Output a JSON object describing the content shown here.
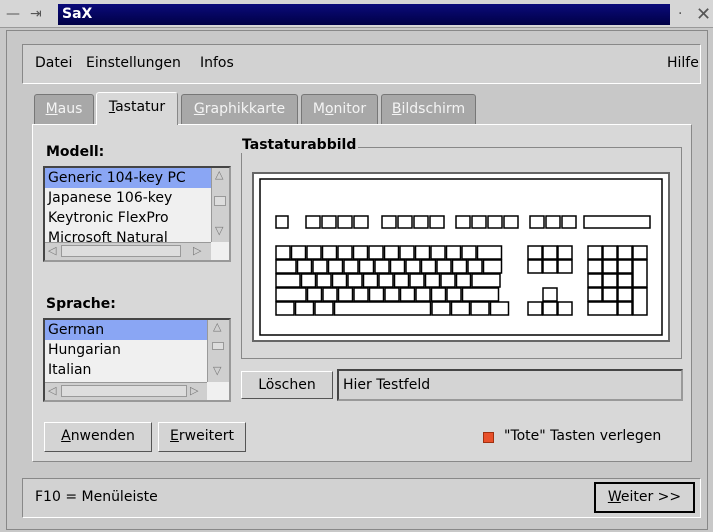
{
  "window": {
    "title": "SaX"
  },
  "menu": {
    "items": [
      "Datei",
      "Einstellungen",
      "Infos"
    ],
    "help": "Hilfe"
  },
  "tabs": [
    {
      "label": "Maus",
      "mnemonic": "M",
      "rest": "aus"
    },
    {
      "label": "Tastatur",
      "mnemonic": "T",
      "rest": "astatur"
    },
    {
      "label": "Graphikkarte",
      "mnemonic": "G",
      "rest": "raphikkarte"
    },
    {
      "label": "Monitor",
      "pre": "M",
      "mnemonic": "o",
      "rest": "nitor"
    },
    {
      "label": "Bildschirm",
      "mnemonic": "B",
      "rest": "ildschirm"
    }
  ],
  "model": {
    "label": "Modell:",
    "items": [
      "Generic 104-key PC",
      "Japanese 106-key",
      "Keytronic FlexPro",
      "Microsoft Natural"
    ]
  },
  "language": {
    "label": "Sprache:",
    "items": [
      "German",
      "Hungarian",
      "Italian"
    ]
  },
  "keyboard_group": {
    "label": "Tastaturabbild"
  },
  "test": {
    "clear_button": "Löschen",
    "field_value": "Hier Testfeld"
  },
  "actions": {
    "apply": {
      "mnemonic": "A",
      "rest": "nwenden"
    },
    "advanced": {
      "mnemonic": "E",
      "rest": "rweitert"
    }
  },
  "dead_keys": {
    "label": "\"Tote\" Tasten verlegen",
    "checked": true,
    "color": "#e8502a"
  },
  "status": {
    "text": "F10 = Menüleiste"
  },
  "next": {
    "mnemonic": "W",
    "rest": "eiter >>"
  },
  "colors": {
    "title_bg": "#000046",
    "selection": "#8aa6f4"
  }
}
